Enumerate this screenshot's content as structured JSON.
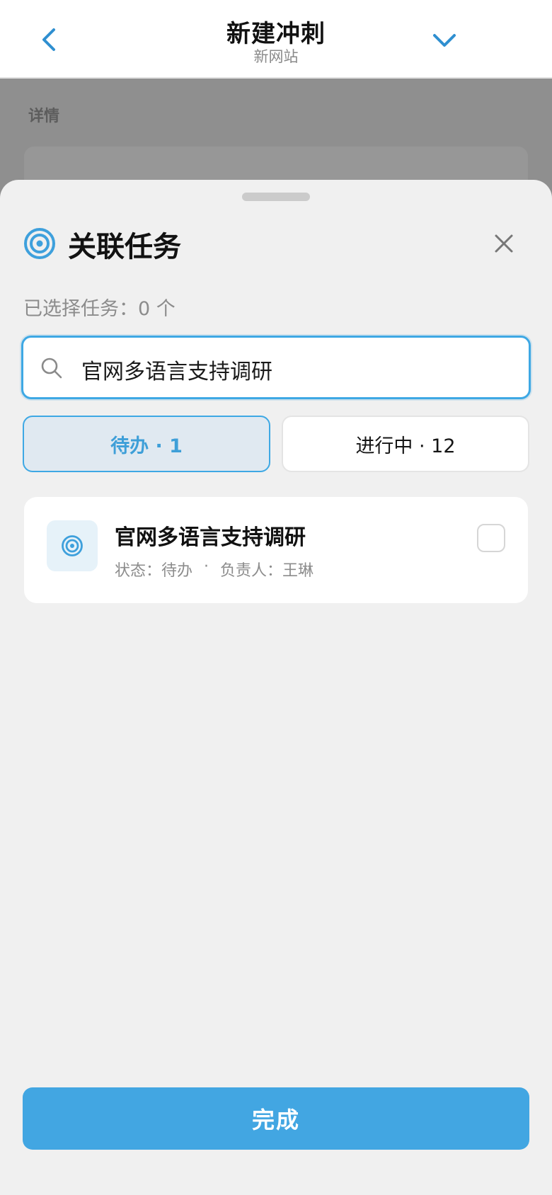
{
  "nav": {
    "title": "新建冲刺",
    "subtitle": "新网站",
    "back_icon": "chevron-left-icon",
    "collapse_icon": "chevron-down-icon"
  },
  "background": {
    "section_label": "详情"
  },
  "sheet": {
    "title": "关联任务",
    "title_icon": "target-icon",
    "close_icon": "close-icon",
    "selected_text": "已选择任务：0 个",
    "search": {
      "value": "官网多语言支持调研",
      "icon": "search-icon"
    },
    "tabs": [
      {
        "label": "待办 · 1",
        "active": true
      },
      {
        "label": "进行中 · 12",
        "active": false
      }
    ],
    "tasks": [
      {
        "name": "官网多语言支持调研",
        "status": "状态：待办",
        "separator": "·",
        "assignee": "负责人：王琳",
        "checked": false,
        "icon": "target-icon"
      }
    ],
    "done_label": "完成"
  },
  "colors": {
    "accent": "#42a6e2",
    "tab_active_bg": "#e0e9f1",
    "overlay": "#8f8f8f",
    "sheet_bg": "#f0f0f0"
  }
}
